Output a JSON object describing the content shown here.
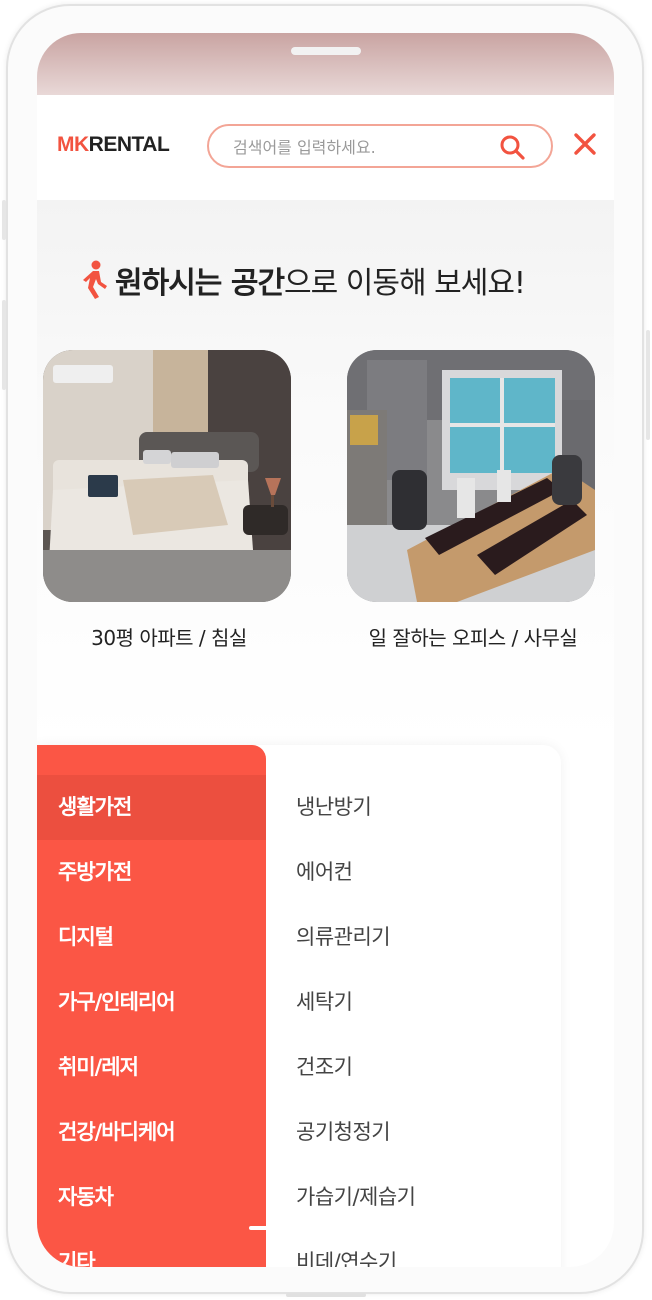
{
  "header": {
    "logo_mk": "MK",
    "logo_rental": "RENTAL",
    "search_placeholder": "검색어를 입력하세요."
  },
  "space": {
    "heading_bold": "원하시는 공간",
    "heading_rest": "으로 이동해 보세요!",
    "cards": [
      {
        "label": "30평 아파트 / 침실",
        "icon": "bedroom-photo"
      },
      {
        "label": "일 잘하는 오피스 / 사무실",
        "icon": "office-photo"
      }
    ]
  },
  "categories": {
    "main": [
      "생활가전",
      "주방가전",
      "디지털",
      "가구/인테리어",
      "취미/레저",
      "건강/바디케어",
      "자동차",
      "기타"
    ],
    "active_index": 0,
    "sub": [
      "냉난방기",
      "에어컨",
      "의류관리기",
      "세탁기",
      "건조기",
      "공기청정기",
      "가습기/제습기",
      "비데/연수기"
    ]
  },
  "colors": {
    "accent": "#fb5645",
    "accent_dark": "#ec4f3f",
    "search_border": "#f3a596"
  }
}
